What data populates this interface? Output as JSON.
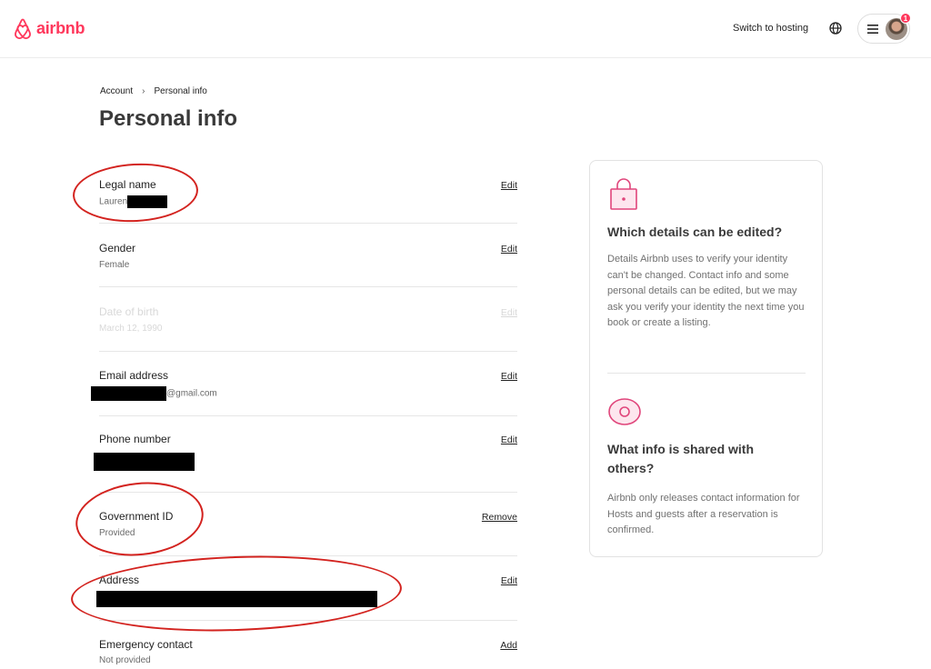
{
  "brand": {
    "name": "airbnb",
    "color": "#ff385c"
  },
  "header": {
    "switch_hosting": "Switch to hosting",
    "globe_icon": "globe-icon",
    "menu_icon": "hamburger-menu-icon",
    "notification_count": "1"
  },
  "breadcrumb": {
    "parent": "Account",
    "separator": "›",
    "current": "Personal info"
  },
  "page": {
    "title": "Personal info"
  },
  "fields": [
    {
      "label": "Legal name",
      "value": "Lauren",
      "action": "Edit"
    },
    {
      "label": "Gender",
      "value": "Female",
      "action": "Edit"
    },
    {
      "label": "Date of birth",
      "value": "March 12, 1990",
      "action": "Edit"
    },
    {
      "label": "Email address",
      "value": "@gmail.com",
      "action": "Edit"
    },
    {
      "label": "Phone number",
      "value": "",
      "action": "Edit"
    },
    {
      "label": "Government ID",
      "value": "Provided",
      "action": "Remove"
    },
    {
      "label": "Address",
      "value": "",
      "action": "Edit"
    },
    {
      "label": "Emergency contact",
      "value": "Not provided",
      "action": "Add"
    }
  ],
  "info_card": {
    "section1": {
      "icon": "lock-icon",
      "title": "Which details can be edited?",
      "text": "Details Airbnb uses to verify your identity can't be changed. Contact info and some personal details can be edited, but we may ask you verify your identity the next time you book or create a listing."
    },
    "section2": {
      "icon": "eye-icon",
      "title": "What info is shared with others?",
      "text": "Airbnb only releases contact information for Hosts and guests after a reservation is confirmed."
    }
  },
  "annotation_color": "#d3231f"
}
